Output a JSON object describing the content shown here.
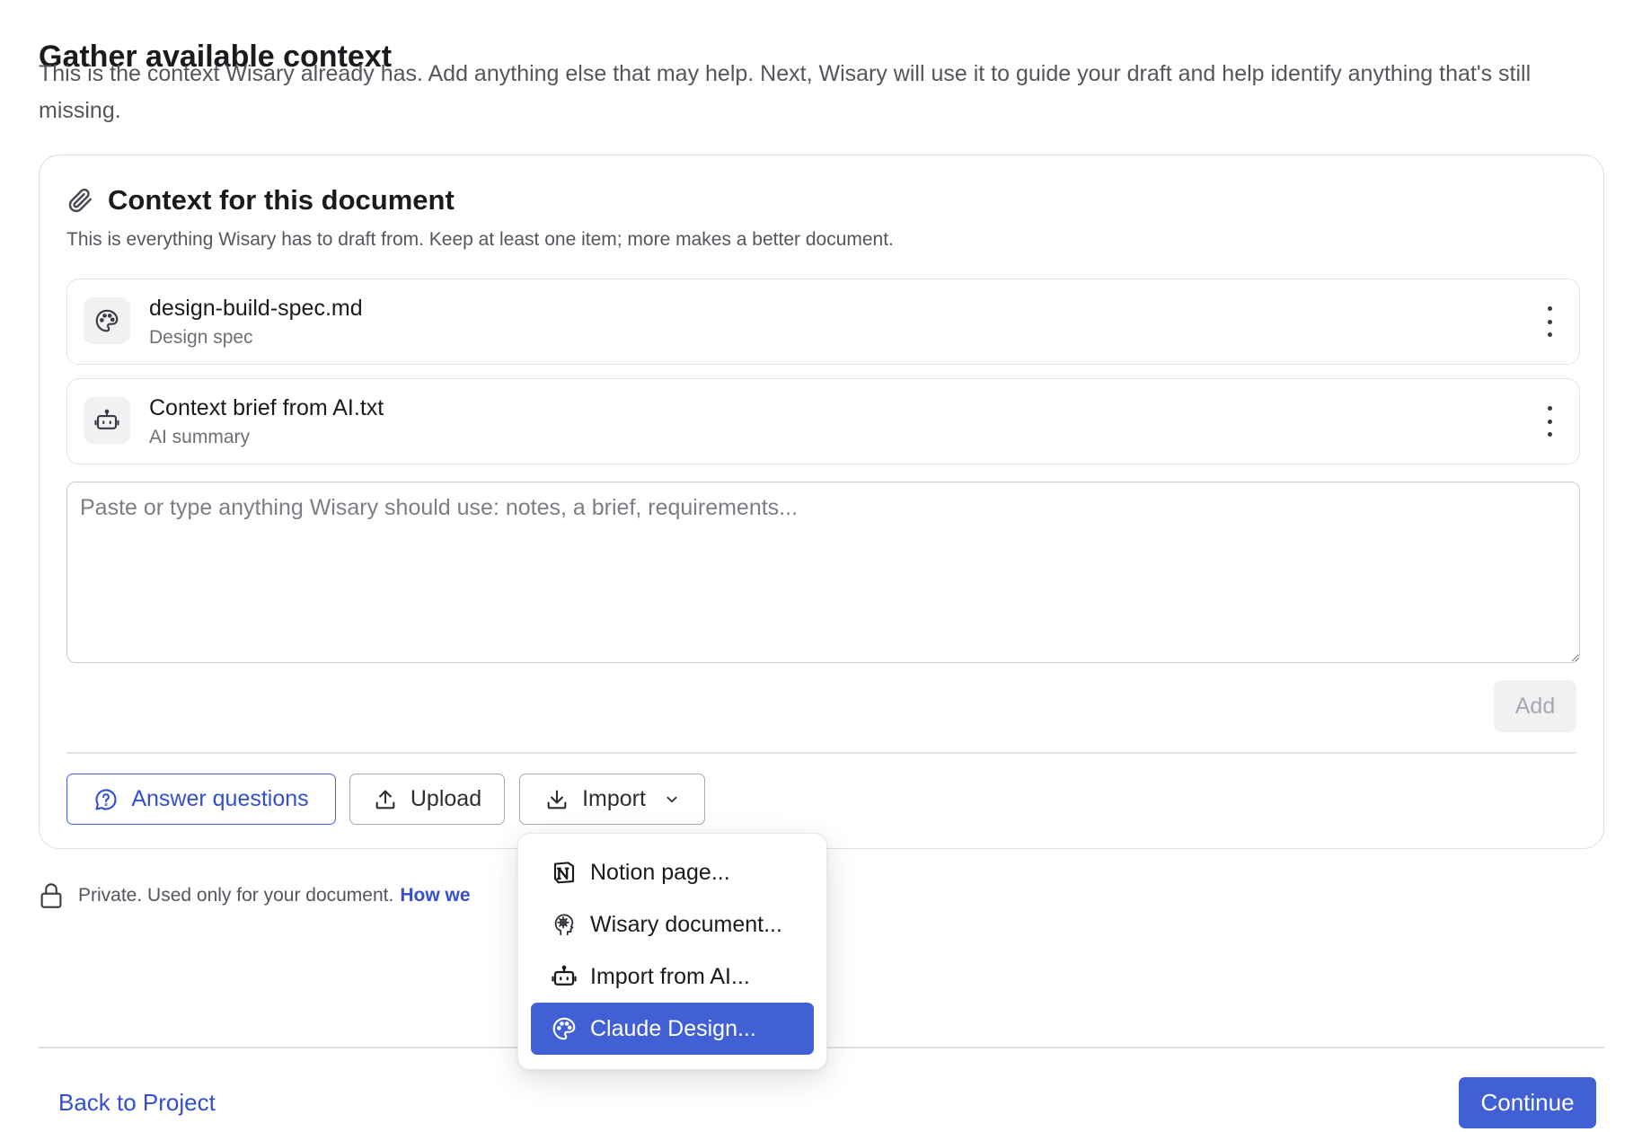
{
  "header": {
    "title": "Gather available context",
    "subtitle": "This is the context Wisary already has. Add anything else that may help. Next, Wisary will use it to guide your draft and help identify anything that's still missing."
  },
  "card": {
    "icon": "paperclip-icon",
    "title": "Context for this document",
    "description": "This is everything Wisary has to draft from. Keep at least one item; more makes a better document.",
    "items": [
      {
        "name": "design-build-spec.md",
        "type": "Design spec",
        "icon": "palette-icon"
      },
      {
        "name": "Context brief from AI.txt",
        "type": "AI summary",
        "icon": "robot-icon"
      }
    ],
    "input_placeholder": "Paste or type anything Wisary should use: notes, a brief, requirements...",
    "input_value": "",
    "add_label": "Add",
    "actions": {
      "answer_label": "Answer questions",
      "upload_label": "Upload",
      "import_label": "Import"
    }
  },
  "privacy": {
    "text": "Private. Used only for your document.",
    "link": "How we"
  },
  "import_menu": {
    "items": [
      {
        "label": "Notion page...",
        "icon": "notion-icon"
      },
      {
        "label": "Wisary document...",
        "icon": "wisary-logo-icon"
      },
      {
        "label": "Import from AI...",
        "icon": "robot-icon"
      },
      {
        "label": "Claude Design...",
        "icon": "palette-icon",
        "highlighted": true
      }
    ]
  },
  "footer": {
    "back_label": "Back to Project",
    "continue_label": "Continue"
  },
  "colors": {
    "accent": "#4260d6",
    "link": "#3450cf",
    "muted_text": "#55565d"
  }
}
